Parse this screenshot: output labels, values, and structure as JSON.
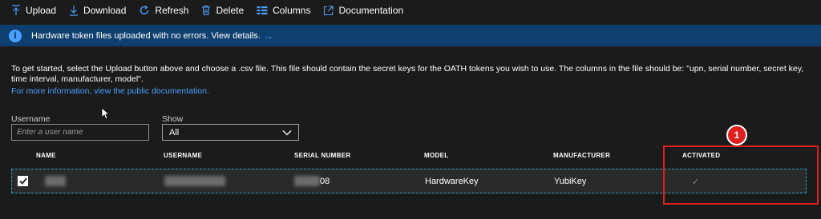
{
  "toolbar": {
    "upload": "Upload",
    "download": "Download",
    "refresh": "Refresh",
    "delete": "Delete",
    "columns": "Columns",
    "documentation": "Documentation"
  },
  "banner": {
    "text": "Hardware token files uploaded with no errors. View details.",
    "arrow": "→",
    "icon": "info-icon"
  },
  "intro": {
    "text": "To get started, select the Upload button above and choose a .csv file. This file should contain the secret keys for the OATH tokens you wish to use. The columns in the file should be: \"upn, serial number, secret key, time interval, manufacturer, model\".",
    "link": "For more information, view the public documentation."
  },
  "filters": {
    "username_label": "Username",
    "username_placeholder": "Enter a user name",
    "show_label": "Show",
    "show_value": "All"
  },
  "table": {
    "columns": [
      "NAME",
      "USERNAME",
      "SERIAL NUMBER",
      "MODEL",
      "MANUFACTURER",
      "ACTIVATED"
    ],
    "rows": [
      {
        "serial_suffix": "08",
        "model": "HardwareKey",
        "manufacturer": "YubiKey",
        "activated": "✓"
      }
    ]
  },
  "annotation": {
    "badge": "1",
    "color": "#e02020"
  },
  "colors": {
    "background": "#1b1b1b",
    "banner": "#0f3f6e",
    "accent": "#4aa0ff",
    "row": "#2a2a2a",
    "row_border": "#2aa3c9"
  }
}
